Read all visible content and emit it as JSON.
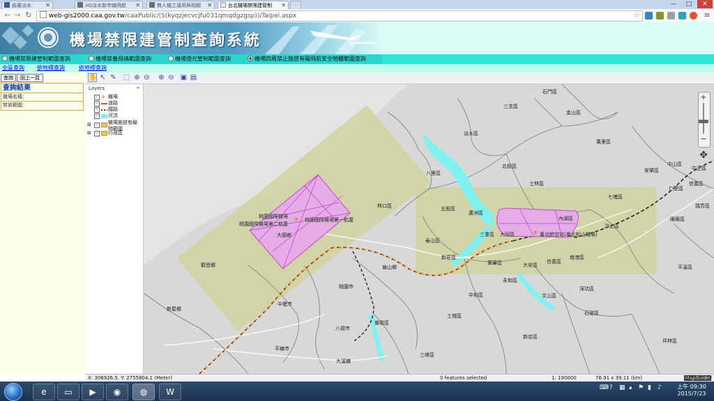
{
  "browser": {
    "tabs": [
      {
        "title": "臉書淡水",
        "icon": "facebook-icon",
        "active": false
      },
      {
        "title": "AQ淡水新市鎮飛航",
        "icon": "building-icon",
        "active": false
      },
      {
        "title": "無人機之運用與相關",
        "icon": "building-icon",
        "active": false
      },
      {
        "title": "台北機場禁限建管制",
        "icon": "page-icon",
        "active": true
      }
    ],
    "url_host": "web-gis2000.caa.gov.tw",
    "url_path": "/caaPublic/(S(kyqzjecvcjfu031qmqdgzgsp))/Taipei.aspx",
    "window_controls": [
      "—",
      "□",
      "✕"
    ]
  },
  "banner": {
    "title": "機場禁限建管制查詢系統"
  },
  "query_modes": [
    {
      "label": "機場禁限建管制範圍查詢",
      "selected": false
    },
    {
      "label": "機場禁養飛鴿範圍查詢",
      "selected": false
    },
    {
      "label": "機場燈光管制範圍查詢",
      "selected": false
    },
    {
      "label": "機場四周禁止施放有礙飛航安全物體範圍查詢",
      "selected": true
    }
  ],
  "search_links": [
    "全區查詢",
    "依地標查詢",
    "依地標查詢"
  ],
  "left_panel": {
    "buttons": [
      "查詢",
      "回上一頁"
    ],
    "results_title": "查詢結果",
    "rows": [
      "機場名稱：",
      "禁放範圍："
    ]
  },
  "layers": {
    "title": "Layers",
    "items": [
      {
        "label": "機場",
        "checked": true,
        "symbol": "plane-symbol"
      },
      {
        "label": "道路",
        "checked": true,
        "symbol": "road-symbol"
      },
      {
        "label": "鐵路",
        "checked": true,
        "symbol": "rail-symbol"
      },
      {
        "label": "河流",
        "checked": true,
        "symbol": "river-symbol"
      },
      {
        "label": "機場施放有礙物範圍",
        "checked": true,
        "symbol": "folder-icon",
        "expandable": true
      },
      {
        "label": "行政區",
        "checked": true,
        "symbol": "folder-icon",
        "expandable": true
      }
    ]
  },
  "map": {
    "labels": [
      "石門區",
      "三芝區",
      "金山區",
      "淡水區",
      "萬里區",
      "北投區",
      "中山區",
      "中正區",
      "安樂區",
      "八里區",
      "士林區",
      "信義區",
      "仁愛區",
      "七堵區",
      "瑞芳區",
      "林口區",
      "五股區",
      "蘆洲區",
      "內湖區",
      "汐止區",
      "桃園國際機場",
      "桃園國際機場第二航廈",
      "桃園國際機場第一航廈",
      "大園鄉",
      "三重區",
      "大同區",
      "臺北航空站(臺北松山機場)",
      "泰山區",
      "暖暖區",
      "新莊區",
      "萬華區",
      "大安區",
      "信義區",
      "南港區",
      "觀音鄉",
      "龜山鄉",
      "永和區",
      "平溪區",
      "深坑區",
      "桃園市",
      "中和區",
      "文山區",
      "中壢市",
      "土城區",
      "石碇區",
      "新屋鄉",
      "八德市",
      "鶯歌區",
      "新店區",
      "坪林區",
      "平鎮市",
      "大溪鎮",
      "三峽區"
    ],
    "colors": {
      "zone": "#d2d2a0",
      "airport_zone": "#e7a8ee",
      "airport_outline": "#c03ad0",
      "river": "#7ff2f0",
      "boundary": "#7a7a7a",
      "rail": "#e58a2a"
    }
  },
  "status": {
    "coords": "X: 306926.5, Y: 2755804.1 (Meter)",
    "features": "0 features selected",
    "scale": "1: 190000",
    "size": "76.91 x 39.11 (km)",
    "powered_by": "Powered by",
    "brand": "MapGuide"
  },
  "taskbar": {
    "apps": [
      {
        "name": "internet-explorer-icon",
        "glyph": "e"
      },
      {
        "name": "folder-icon",
        "glyph": "▭"
      },
      {
        "name": "media-player-icon",
        "glyph": "▶"
      },
      {
        "name": "qq-icon",
        "glyph": "◉"
      },
      {
        "name": "chrome-icon",
        "glyph": "◍"
      },
      {
        "name": "word-icon",
        "glyph": "W"
      }
    ],
    "clock_time": "上午 09:30",
    "clock_date": "2015/7/23"
  }
}
